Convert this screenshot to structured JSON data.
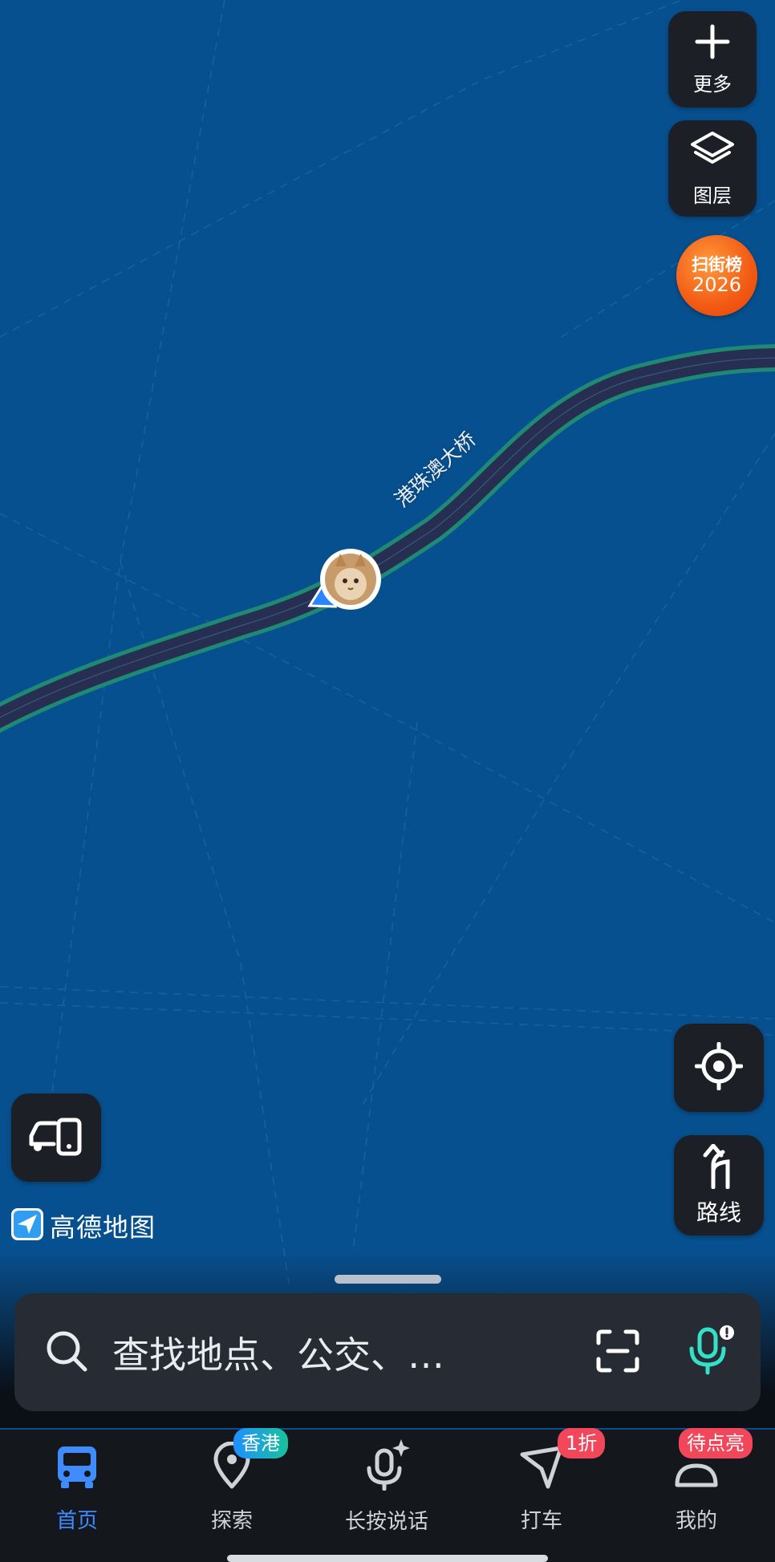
{
  "map": {
    "road_label": "港珠澳大桥",
    "background_color": "#07508f",
    "road_color": "#262f52",
    "road_edge_color": "#1f8a74"
  },
  "controls": {
    "more_label": "更多",
    "layers_label": "图层",
    "badge_line1": "扫街榜",
    "badge_line2": "2026",
    "route_label": "路线"
  },
  "logo": {
    "text": "高德地图"
  },
  "search": {
    "placeholder": "查找地点、公交、…"
  },
  "tabs": [
    {
      "label": "首页",
      "icon": "bus-icon",
      "active": true
    },
    {
      "label": "探索",
      "icon": "location-pin-icon",
      "badge": "香港"
    },
    {
      "label": "长按说话",
      "icon": "microphone-sparkle-icon"
    },
    {
      "label": "打车",
      "icon": "taxi-arrow-icon",
      "badge": "1折"
    },
    {
      "label": "我的",
      "icon": "profile-icon",
      "badge": "待点亮"
    }
  ]
}
